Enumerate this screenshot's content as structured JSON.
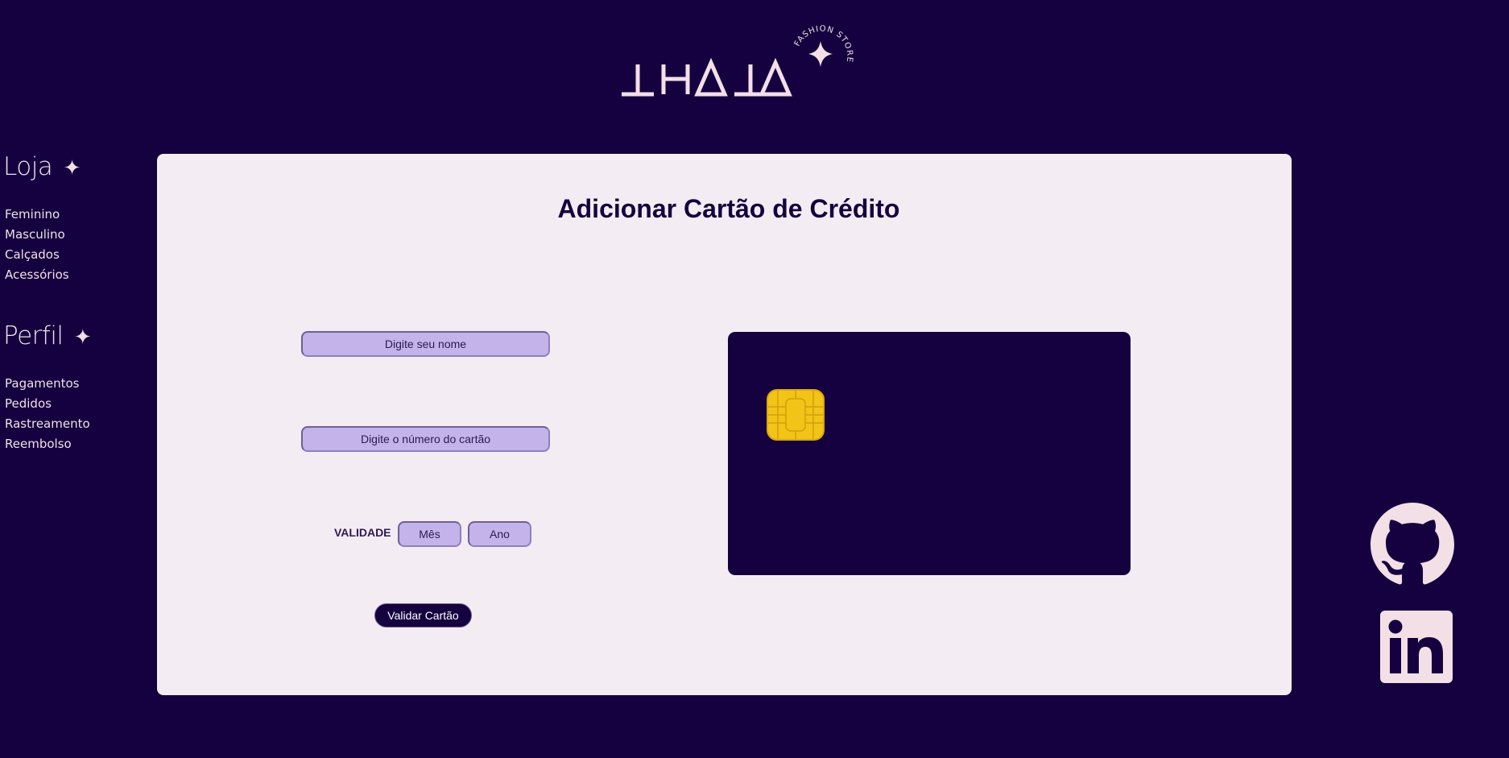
{
  "brand": {
    "name": "THATA",
    "tagline": "FASHION STORE",
    "color": "#f3dfe6"
  },
  "sidebar": {
    "store": {
      "heading": "Loja",
      "star": "✦",
      "items": [
        "Feminino",
        "Masculino",
        "Calçados",
        "Acessórios"
      ]
    },
    "profile": {
      "heading": "Perfil",
      "star": "✦",
      "items": [
        "Pagamentos",
        "Pedidos",
        "Rastreamento",
        "Reembolso"
      ]
    }
  },
  "main": {
    "title": "Adicionar Cartão de Crédito",
    "form": {
      "name_placeholder": "Digite seu nome",
      "number_placeholder": "Digite o número do cartão",
      "validity_label": "VALIDADE",
      "month_placeholder": "Mês",
      "year_placeholder": "Ano",
      "submit_label": "Validar Cartão"
    },
    "card_preview": {
      "background": "#15013f",
      "chip_color": "#f2c418"
    }
  },
  "social": {
    "github_icon": "github-icon",
    "linkedin_icon": "linkedin-icon"
  },
  "colors": {
    "background": "#15013f",
    "panel": "#f3edf3",
    "input": "#c3b3ea",
    "accent_text": "#f3dfe6"
  }
}
